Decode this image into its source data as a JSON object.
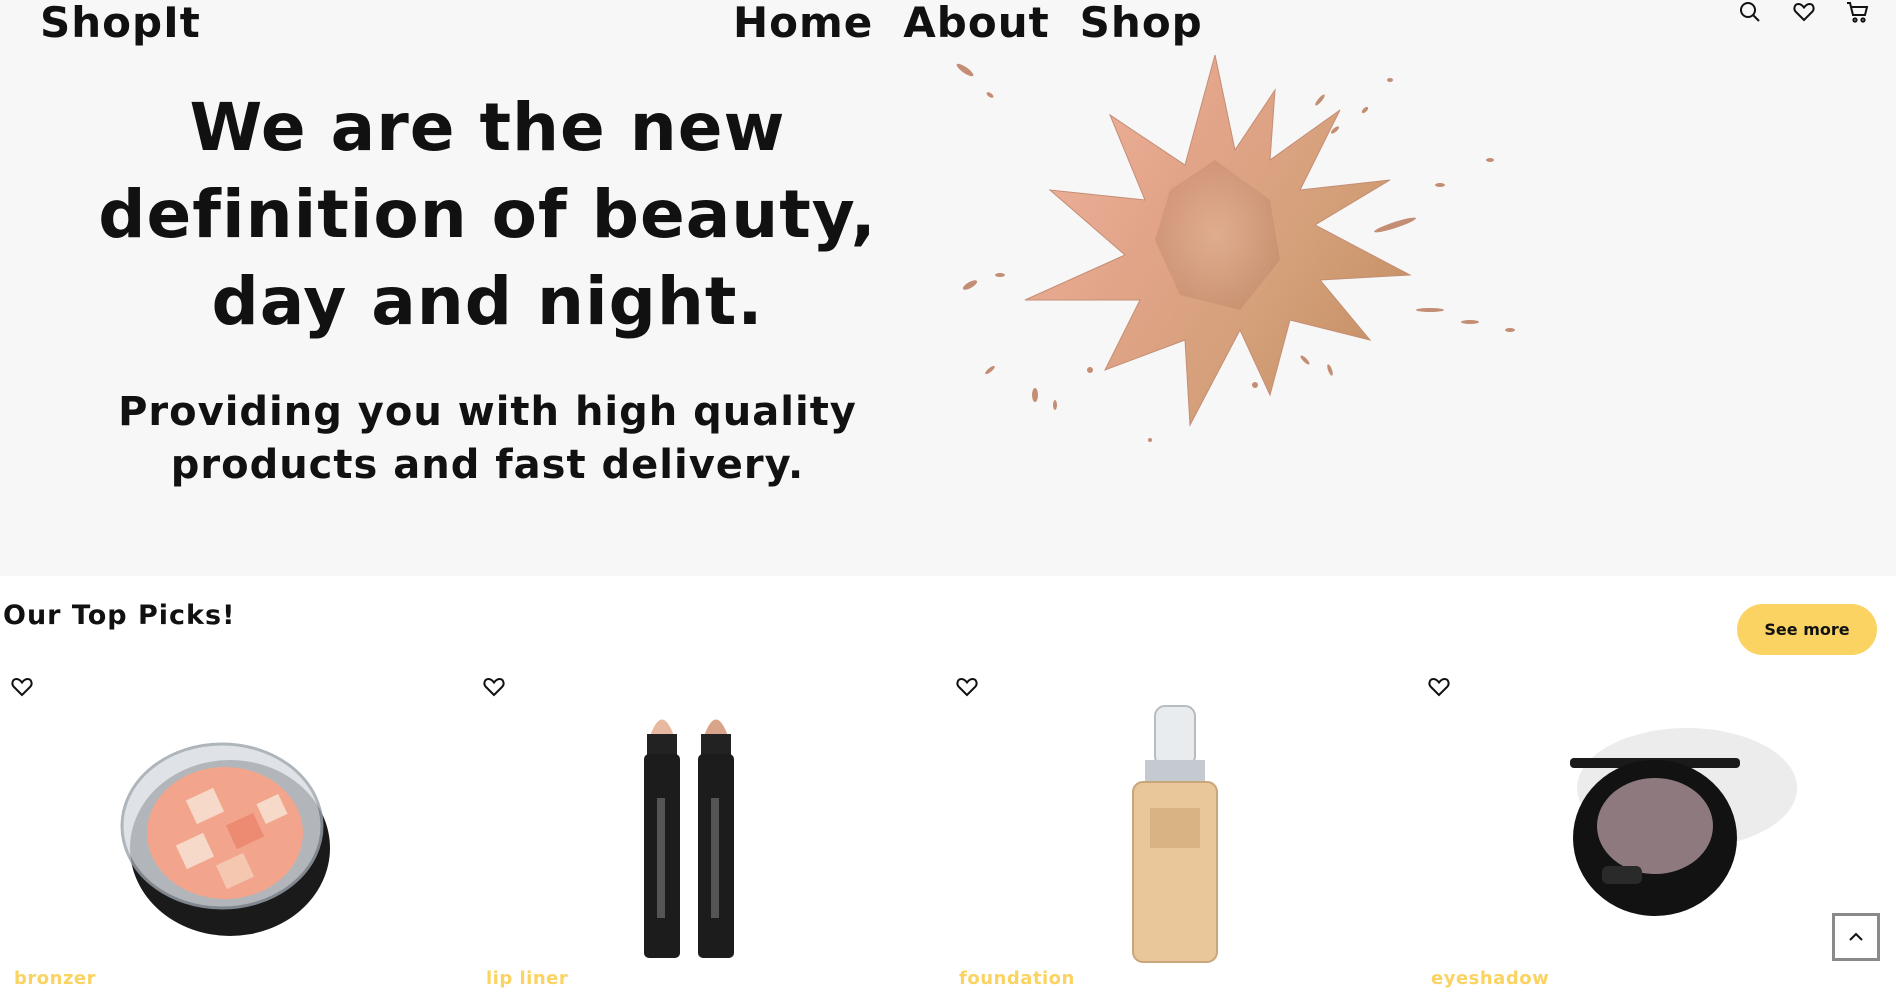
{
  "header": {
    "logo": "ShopIt",
    "nav": [
      "Home",
      "About",
      "Shop"
    ],
    "icons": [
      "search-icon",
      "heart-icon",
      "cart-icon"
    ]
  },
  "hero": {
    "headline_lines": [
      "We are the new",
      "definition of beauty,",
      "day and night."
    ],
    "sub_lines": [
      "Providing you with high quality",
      "products and fast delivery."
    ]
  },
  "picks": {
    "title": "Our Top Picks!",
    "see_more": "See more",
    "items": [
      {
        "category": "bronzer"
      },
      {
        "category": "lip liner"
      },
      {
        "category": "foundation"
      },
      {
        "category": "eyeshadow"
      }
    ]
  },
  "colors": {
    "accent": "#fbd362",
    "hero_bg": "#f7f7f7",
    "text": "#111111"
  }
}
